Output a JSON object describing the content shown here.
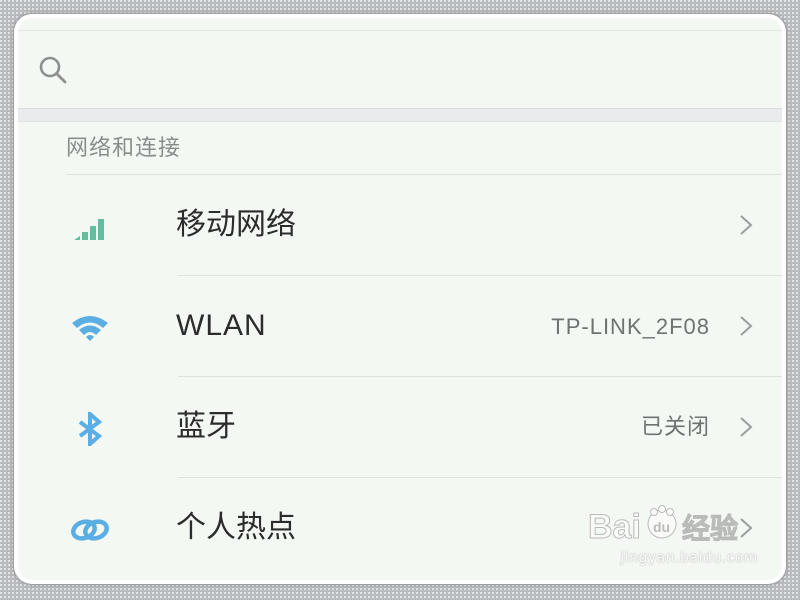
{
  "search": {
    "icon": "search-icon",
    "placeholder": ""
  },
  "section": {
    "title": "网络和连接"
  },
  "rows": [
    {
      "label": "移动网络",
      "value": "",
      "icon": "signal-bars-icon",
      "icon_color": "#5fbf9f"
    },
    {
      "label": "WLAN",
      "value": "TP-LINK_2F08",
      "icon": "wifi-icon",
      "icon_color": "#5aaee3"
    },
    {
      "label": "蓝牙",
      "value": "已关闭",
      "icon": "bluetooth-icon",
      "icon_color": "#5aaee3"
    },
    {
      "label": "个人热点",
      "value": "",
      "icon": "hotspot-link-icon",
      "icon_color": "#5aaee3"
    }
  ],
  "watermark": {
    "brand": "Baidu经验",
    "url": "jingyan.baidu.com"
  },
  "colors": {
    "background": "#f4f8f3",
    "divider": "#dfe3de",
    "accent_green": "#5fbf9f",
    "accent_blue": "#5aaee3"
  }
}
